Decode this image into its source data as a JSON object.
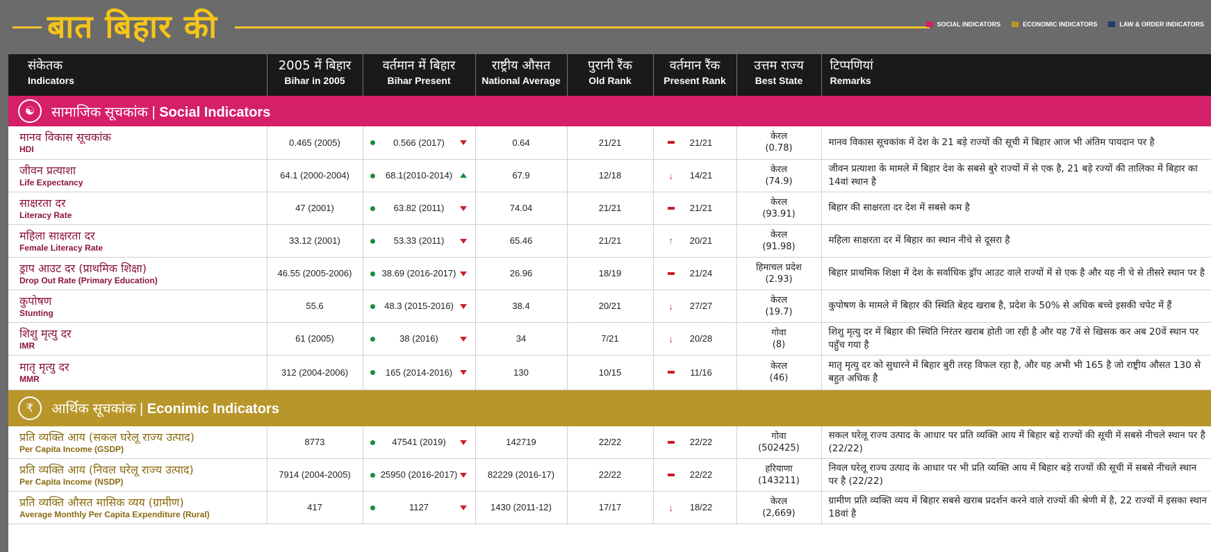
{
  "header": {
    "logo": "बात बिहार की",
    "legend": [
      {
        "label": "SOCIAL INDICATORS",
        "color": "#d61f69"
      },
      {
        "label": "ECONOMIC INDICATORS",
        "color": "#b8962a"
      },
      {
        "label": "LAW & ORDER INDICATORS",
        "color": "#1f3a6b"
      }
    ]
  },
  "columns": [
    {
      "hi": "संकेतक",
      "en": "Indicators"
    },
    {
      "hi": "2005 में बिहार",
      "en": "Bihar in 2005"
    },
    {
      "hi": "वर्तमान में बिहार",
      "en": "Bihar Present"
    },
    {
      "hi": "राष्ट्रीय औसत",
      "en": "National Average"
    },
    {
      "hi": "पुरानी रैंक",
      "en": "Old Rank"
    },
    {
      "hi": "वर्तमान रैंक",
      "en": "Present Rank"
    },
    {
      "hi": "उत्तम राज्य",
      "en": "Best State"
    },
    {
      "hi": "टिप्पणियां",
      "en": "Remarks"
    }
  ],
  "social": {
    "title_hi": "सामाजिक सूचकांक |",
    "title_en": "Social Indicators",
    "rows": [
      {
        "hi": "मानव विकास सूचकांक",
        "en": "HDI",
        "y2005": "0.465 (2005)",
        "present": "0.566 (2017)",
        "trend": "down",
        "national": "0.64",
        "old_rank": "21/21",
        "present_rank": "21/21",
        "rank_change": "same",
        "best_state": "केरल",
        "best_value": "(0.78)",
        "remarks": "मानव विकास सूचकांक में देश के 21 बड़े राज्यों की सूची में बिहार आज भी अंतिम पायदान पर है"
      },
      {
        "hi": "जीवन प्रत्याशा",
        "en": "Life Expectancy",
        "y2005": "64.1 (2000-2004)",
        "present": "68.1(2010-2014)",
        "trend": "up",
        "national": "67.9",
        "old_rank": "12/18",
        "present_rank": "14/21",
        "rank_change": "down",
        "best_state": "केरल",
        "best_value": "(74.9)",
        "remarks": "जीवन प्रत्याशा के मामले में बिहार देश के सबसे बुरे राज्यों में से एक है, 21 बड़े रज्यों की तालिका में बिहार का 14वां स्थान है"
      },
      {
        "hi": "साक्षरता दर",
        "en": "Literacy Rate",
        "y2005": "47 (2001)",
        "present": "63.82 (2011)",
        "trend": "down",
        "national": "74.04",
        "old_rank": "21/21",
        "present_rank": "21/21",
        "rank_change": "same",
        "best_state": "केरल",
        "best_value": "(93.91)",
        "remarks": "बिहार की साक्षरता दर देश में सबसे कम है"
      },
      {
        "hi": "महिला साक्षरता दर",
        "en": "Female Literacy Rate",
        "y2005": "33.12 (2001)",
        "present": "53.33 (2011)",
        "trend": "down",
        "national": "65.46",
        "old_rank": "21/21",
        "present_rank": "20/21",
        "rank_change": "up",
        "best_state": "केरल",
        "best_value": "(91.98)",
        "remarks": "महिला साक्षरता दर में बिहार का स्थान नीचे से दूसरा है"
      },
      {
        "hi": "ड्राप आउट दर (प्राथमिक शिक्षा)",
        "en": "Drop Out Rate (Primary Education)",
        "y2005": "46.55 (2005-2006)",
        "present": "38.69 (2016-2017)",
        "trend": "down",
        "national": "26.96",
        "old_rank": "18/19",
        "present_rank": "21/24",
        "rank_change": "same",
        "best_state": "हिमाचल प्रदेश",
        "best_value": "(2.93)",
        "remarks": "बिहार प्राथमिक शिक्षा में देश के सर्वाधिक ड्रॉप आउट वाले राज्यों में से एक है और यह नी चे से तीसरे स्थान पर है"
      },
      {
        "hi": "कुपोषण",
        "en": "Stunting",
        "y2005": "55.6",
        "present": "48.3 (2015-2016)",
        "trend": "down",
        "national": "38.4",
        "old_rank": "20/21",
        "present_rank": "27/27",
        "rank_change": "down",
        "best_state": "केरल",
        "best_value": "(19.7)",
        "remarks": "कुपोषण के मामले में बिहार की स्थिति बेहद खराब है, प्रदेश के 50% से अधिक बच्चे इसकी चपेट में हैं"
      },
      {
        "hi": "शिशु मृत्यु दर",
        "en": "IMR",
        "y2005": "61 (2005)",
        "present": "38 (2016)",
        "trend": "down",
        "national": "34",
        "old_rank": "7/21",
        "present_rank": "20/28",
        "rank_change": "down",
        "best_state": "गोवा",
        "best_value": "(8)",
        "remarks": "शिशु मृत्यु दर में बिहार की स्थिति निरंतर खराब होती जा रही है और यह 7वें से खिसक कर अब 20वें स्थान पर पहुँच गया है"
      },
      {
        "hi": "मातृ मृत्यु दर",
        "en": "MMR",
        "y2005": "312 (2004-2006)",
        "present": "165 (2014-2016)",
        "trend": "down",
        "national": "130",
        "old_rank": "10/15",
        "present_rank": "11/16",
        "rank_change": "same",
        "best_state": "केरल",
        "best_value": "(46)",
        "remarks": "मातृ मृत्यु दर को सुधारने में बिहार बुरी तरह विफल रहा है, और यह अभी भी 165 है जो राष्ट्रीय औसत 130 से बहुत अधिक है"
      }
    ]
  },
  "economic": {
    "title_hi": "आर्थिक सूचकांक |",
    "title_en": "Econimic Indicators",
    "rows": [
      {
        "hi": "प्रति व्यक्ति आय (सकल घरेलू राज्य उत्पाद)",
        "en": "Per Capita Income  (GSDP)",
        "y2005": "8773",
        "present": "47541 (2019)",
        "trend": "down",
        "national": "142719",
        "old_rank": "22/22",
        "present_rank": "22/22",
        "rank_change": "same",
        "best_state": "गोवा",
        "best_value": "(502425)",
        "remarks": "सकल घरेलू राज्य उत्पाद के आधार पर प्रति व्यक्ति आय में बिहार बड़े राज्यों की सूची में सबसे नीचले स्थान पर है (22/22)"
      },
      {
        "hi": "प्रति व्यक्ति आय (निवल घरेलू राज्य उत्पाद)",
        "en": "Per Capita Income (NSDP)",
        "y2005": "7914 (2004-2005)",
        "present": "25950 (2016-2017)",
        "trend": "down",
        "national": "82229 (2016-17)",
        "old_rank": "22/22",
        "present_rank": "22/22",
        "rank_change": "same",
        "best_state": "हरियाणा",
        "best_value": "(143211)",
        "remarks": "निवल घरेलू राज्य उत्पाद के आधार पर भी प्रति व्यक्ति आय में बिहार बड़े राज्यों की सूची में सबसे नीचले स्थान पर है (22/22)"
      },
      {
        "hi": "प्रति व्यक्ति औसत मासिक व्यय (ग्रामीण)",
        "en": "Average Monthly Per Capita Expenditure (Rural)",
        "y2005": "417",
        "present": "1127",
        "trend": "down",
        "national": "1430 (2011-12)",
        "old_rank": "17/17",
        "present_rank": "18/22",
        "rank_change": "down",
        "best_state": "केरल",
        "best_value": "(2,669)",
        "remarks": "ग्रामीण प्रति व्यक्ति व्यय में बिहार सबसे खराब प्रदर्शन करने वाले राज्यों की श्रेणी में है, 22 राज्यों में इसका स्थान 18वां है"
      }
    ]
  }
}
